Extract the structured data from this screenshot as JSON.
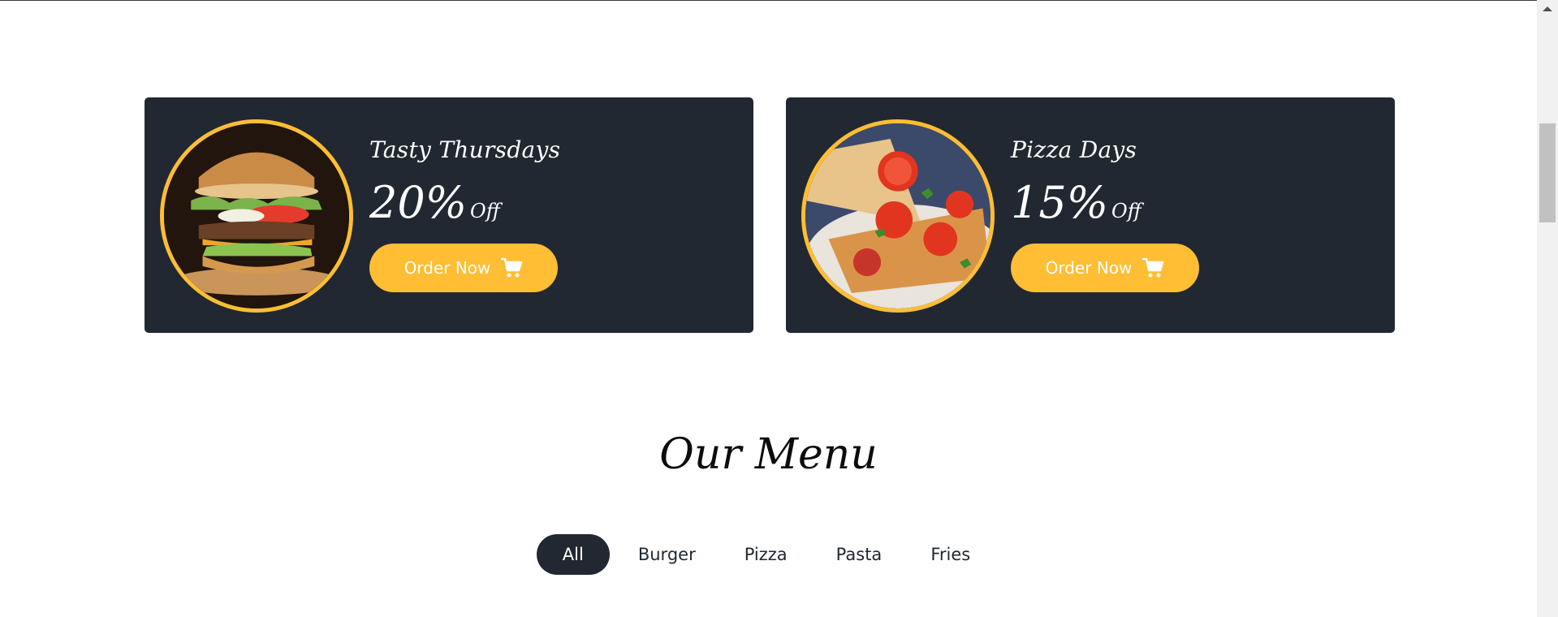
{
  "offers": [
    {
      "title": "Tasty Thursdays",
      "percent": "20%",
      "off_label": "Off",
      "button_label": "Order Now",
      "image": "burger-photo"
    },
    {
      "title": "Pizza Days",
      "percent": "15%",
      "off_label": "Off",
      "button_label": "Order Now",
      "image": "pizza-photo"
    }
  ],
  "menu": {
    "heading": "Our Menu",
    "filters": [
      "All",
      "Burger",
      "Pizza",
      "Pasta",
      "Fries"
    ],
    "active_filter": "All"
  },
  "colors": {
    "card_bg": "#222831",
    "accent": "#ffbe33",
    "text_light": "#ffffff",
    "text_dark": "#0c0c0c"
  },
  "icons": [
    "cart-icon",
    "scroll-up-arrow-icon"
  ]
}
